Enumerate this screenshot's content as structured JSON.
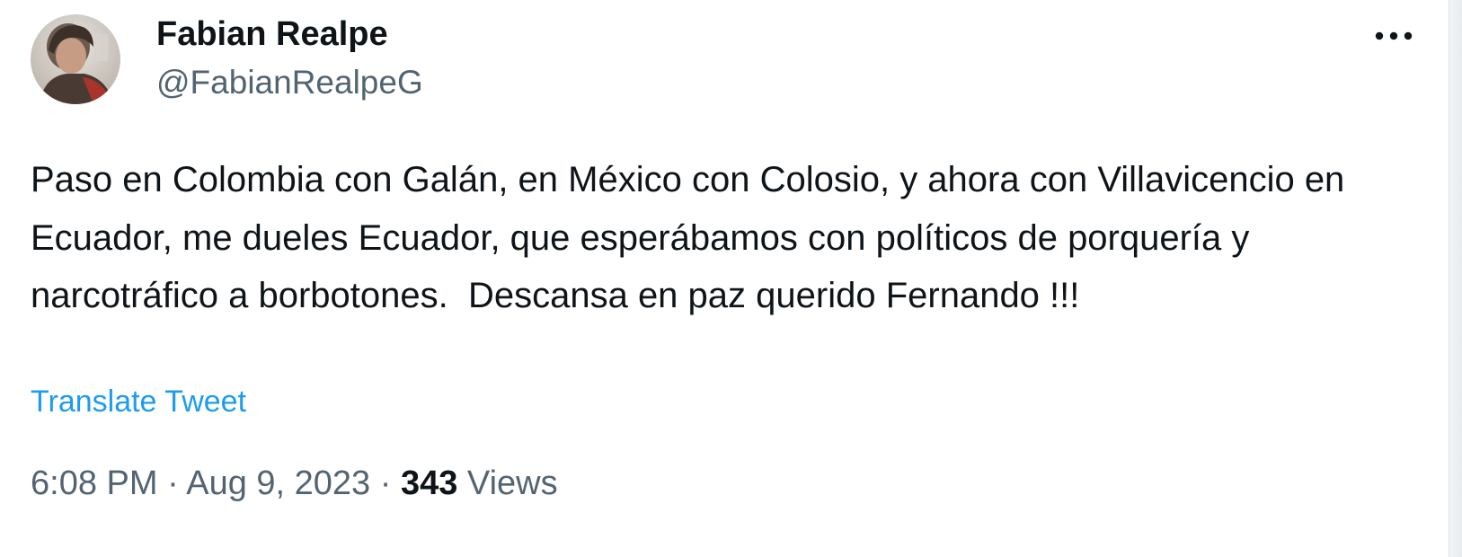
{
  "tweet": {
    "author": {
      "display_name": "Fabian Realpe",
      "handle": "@FabianRealpeG"
    },
    "icons": {
      "avatar": "profile-photo",
      "more": "more-horizontal-icon"
    },
    "text": "Paso en Colombia con Galán, en México con Colosio, y ahora con Villavicencio en Ecuador, me dueles Ecuador, que esperábamos con políticos de porquería y narcotráfico a borbotones.  Descansa en paz querido Fernando !!!",
    "translate_label": "Translate Tweet",
    "meta": {
      "time": "6:08 PM",
      "separator_1": " · ",
      "date": "Aug 9, 2023",
      "separator_2": " · ",
      "views_count": "343",
      "views_label": " Views"
    },
    "colors": {
      "text": "#0f1419",
      "secondary": "#536471",
      "link": "#1d9bf0"
    }
  }
}
